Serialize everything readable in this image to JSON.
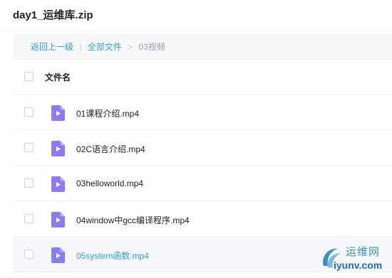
{
  "title": "day1_运维库.zip",
  "breadcrumb": {
    "back": "返回上一级",
    "separator": "|",
    "all_files": "全部文件",
    "arrow": ">",
    "current": "03视频"
  },
  "table": {
    "header": "文件名",
    "files": [
      {
        "name": "01课程介绍.mp4",
        "icon": "video-file-icon"
      },
      {
        "name": "02C语言介绍.mp4",
        "icon": "video-file-icon"
      },
      {
        "name": "03helloworld.mp4",
        "icon": "video-file-icon"
      },
      {
        "name": "04window中gcc编译程序.mp4",
        "icon": "video-file-icon"
      },
      {
        "name": "05system函数.mp4",
        "icon": "video-file-icon"
      }
    ]
  },
  "watermark": {
    "cn": "运维网",
    "domain": "iyunv.com"
  },
  "colors": {
    "link": "#2e9fd6",
    "icon": "#8b7cf6",
    "hover_row": "#f6f8fb",
    "breadcrumb_bg": "#f7f8fa"
  }
}
